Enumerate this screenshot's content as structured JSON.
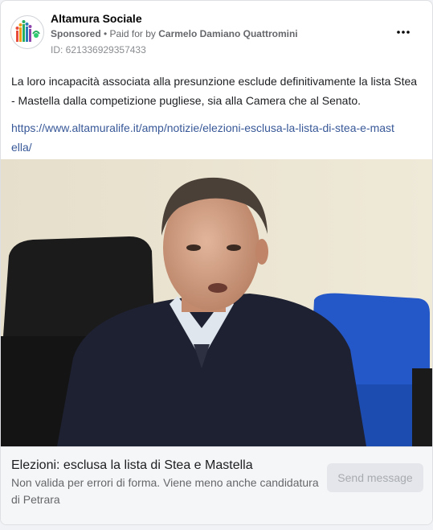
{
  "post": {
    "page_name": "Altamura Sociale",
    "sponsored_label": "Sponsored",
    "separator": " • ",
    "paid_for_label": "Paid for by ",
    "payer": "Carmelo Damiano Quattromini",
    "ad_id": "ID: 621336929357433",
    "more_icon": "more-horizontal-icon",
    "body_text": "La loro incapacità associata alla presunzione esclude definitivamente la lista Stea - Mastella dalla competizione pugliese, sia alla Camera che al Senato.",
    "link_url": "https://www.altamuralife.it/amp/notizie/elezioni-esclusa-la-lista-di-stea-e-mastella/",
    "image_alt": "Man in dark suit speaking, seated in front of a black office chair and a blue chair"
  },
  "link_preview": {
    "title": "Elezioni: esclusa la lista di Stea e Mastella",
    "description": "Non valida per errori di forma. Viene meno anche candidatura di Petrara",
    "cta_label": "Send message"
  },
  "colors": {
    "link": "#385898",
    "secondary_text": "#65676b",
    "button_bg": "#e4e6eb"
  }
}
